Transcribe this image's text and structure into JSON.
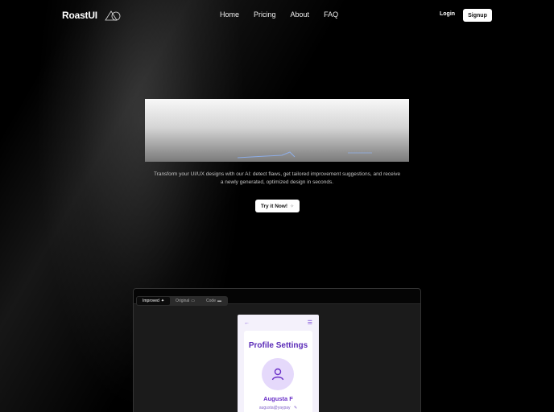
{
  "header": {
    "logo_text": "RoastUI",
    "nav": [
      "Home",
      "Pricing",
      "About",
      "FAQ"
    ],
    "login_label": "Login",
    "signup_label": "Signup"
  },
  "hero": {
    "tagline": "Transform your UI/UX designs with our AI: detect flaws, get tailored improvement suggestions, and receive a newly generated, optimized design in seconds.",
    "cta_label": "Try it Now!",
    "cta_icon": "sparkle-icon"
  },
  "preview": {
    "tabs": [
      {
        "label": "Improved",
        "icon": "sparkle-icon"
      },
      {
        "label": "Original",
        "icon": "image-icon"
      },
      {
        "label": "Code",
        "icon": "code-icon"
      }
    ],
    "active_tab": "Improved",
    "phone": {
      "title": "Profile Settings",
      "user_name": "Augusta F",
      "email": "augusta@yaypay",
      "accent": "#6a30c8"
    }
  }
}
